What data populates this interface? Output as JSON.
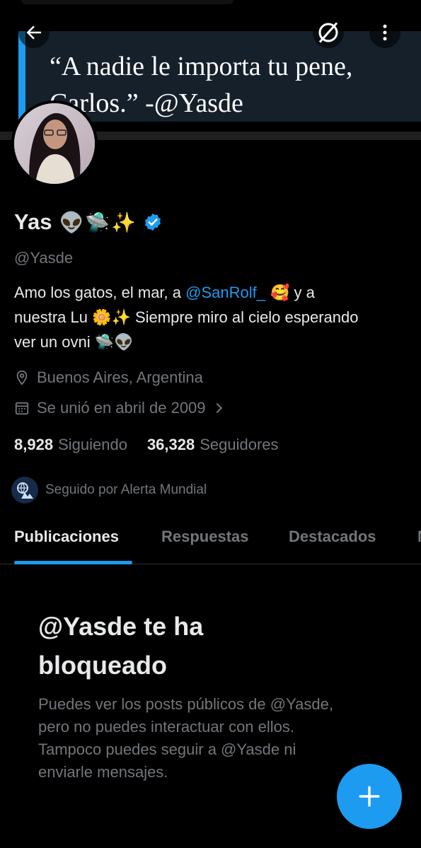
{
  "banner": {
    "quote_line1": "“A nadie le importa tu pene,",
    "quote_line2": "Carlos.” -@Yasde"
  },
  "header": {
    "back_icon": "arrow-left-icon",
    "unmute_icon": "slash-circle-icon",
    "more_icon": "vertical-dots-icon"
  },
  "profile": {
    "name": "Yas",
    "name_emoji": "👽🛸✨",
    "handle": "@Yasde",
    "bio": {
      "line1_text": "Amo los gatos, el mar, a ",
      "line1_mention": "@SanRolf_",
      "line1_emoji": " 🥰",
      "line1_tail": " y a",
      "line2_text": "nuestra Lu ",
      "line2_emoji": "🌼✨",
      "line2_tail": " Siempre miro al cielo esperando",
      "line3_text": "ver un ovni ",
      "line3_emoji": "🛸👽"
    },
    "location": "Buenos Aires, Argentina",
    "joined": "Se unió en abril de 2009",
    "following_count": "8,928",
    "following_label": "Siguiendo",
    "followers_count": "36,328",
    "followers_label": "Seguidores",
    "followed_by": "Seguido por Alerta Mundial"
  },
  "tabs": [
    {
      "label": "Publicaciones",
      "active": true
    },
    {
      "label": "Respuestas",
      "active": false
    },
    {
      "label": "Destacados",
      "active": false
    },
    {
      "label": "M",
      "active": false
    }
  ],
  "blocked": {
    "title_line1": "@Yasde te ha",
    "title_line2": "bloqueado",
    "body_line1": "Puedes ver los posts públicos de @Yasde,",
    "body_line2": "pero no puedes interactuar con ellos.",
    "body_line3": "Tampoco puedes seguir a @Yasde ni",
    "body_line4": "enviarle mensajes."
  },
  "fab": {
    "icon": "plus-icon"
  },
  "colors": {
    "accent": "#1d9bf0",
    "background": "#000000",
    "text_primary": "#e7e9ea",
    "text_secondary": "#71767b",
    "banner_panel": "#15202b"
  }
}
